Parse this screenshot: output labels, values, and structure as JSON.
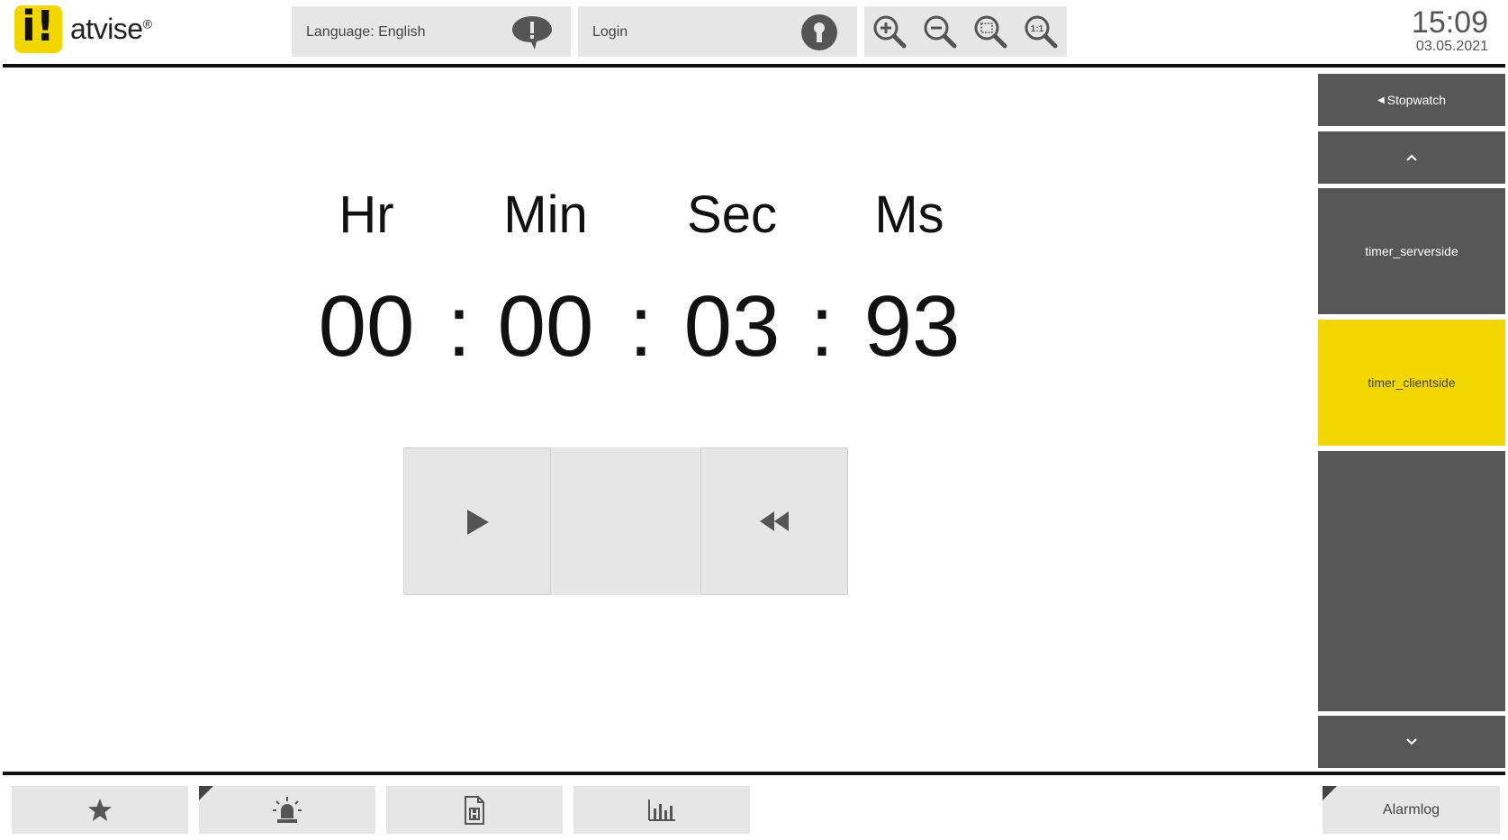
{
  "header": {
    "brand": "atvise",
    "brand_mark": "®",
    "logo_glyph": "i!",
    "language_label": "Language: English",
    "login_label": "Login",
    "zoom_reset_label": "1:1",
    "clock_time": "15:09",
    "clock_date": "03.05.2021"
  },
  "timer": {
    "units": [
      "Hr",
      "Min",
      "Sec",
      "Ms"
    ],
    "values": [
      "00",
      "00",
      "03",
      "93"
    ],
    "separator": ":"
  },
  "controls": {
    "play_icon": "play-icon",
    "rewind_icon": "rewind-icon"
  },
  "sidebar": {
    "back_label": "Stopwatch",
    "items": [
      {
        "label": "timer_serverside",
        "active": false
      },
      {
        "label": "timer_clientside",
        "active": true
      }
    ]
  },
  "footer": {
    "alarmlog_label": "Alarmlog",
    "icons": [
      "star-icon",
      "alarm-siren-icon",
      "history-document-icon",
      "trend-chart-icon"
    ]
  },
  "colors": {
    "accent": "#f2d600",
    "nav_bg": "#575757",
    "panel_bg": "#e6e6e6",
    "icon": "#555555"
  }
}
